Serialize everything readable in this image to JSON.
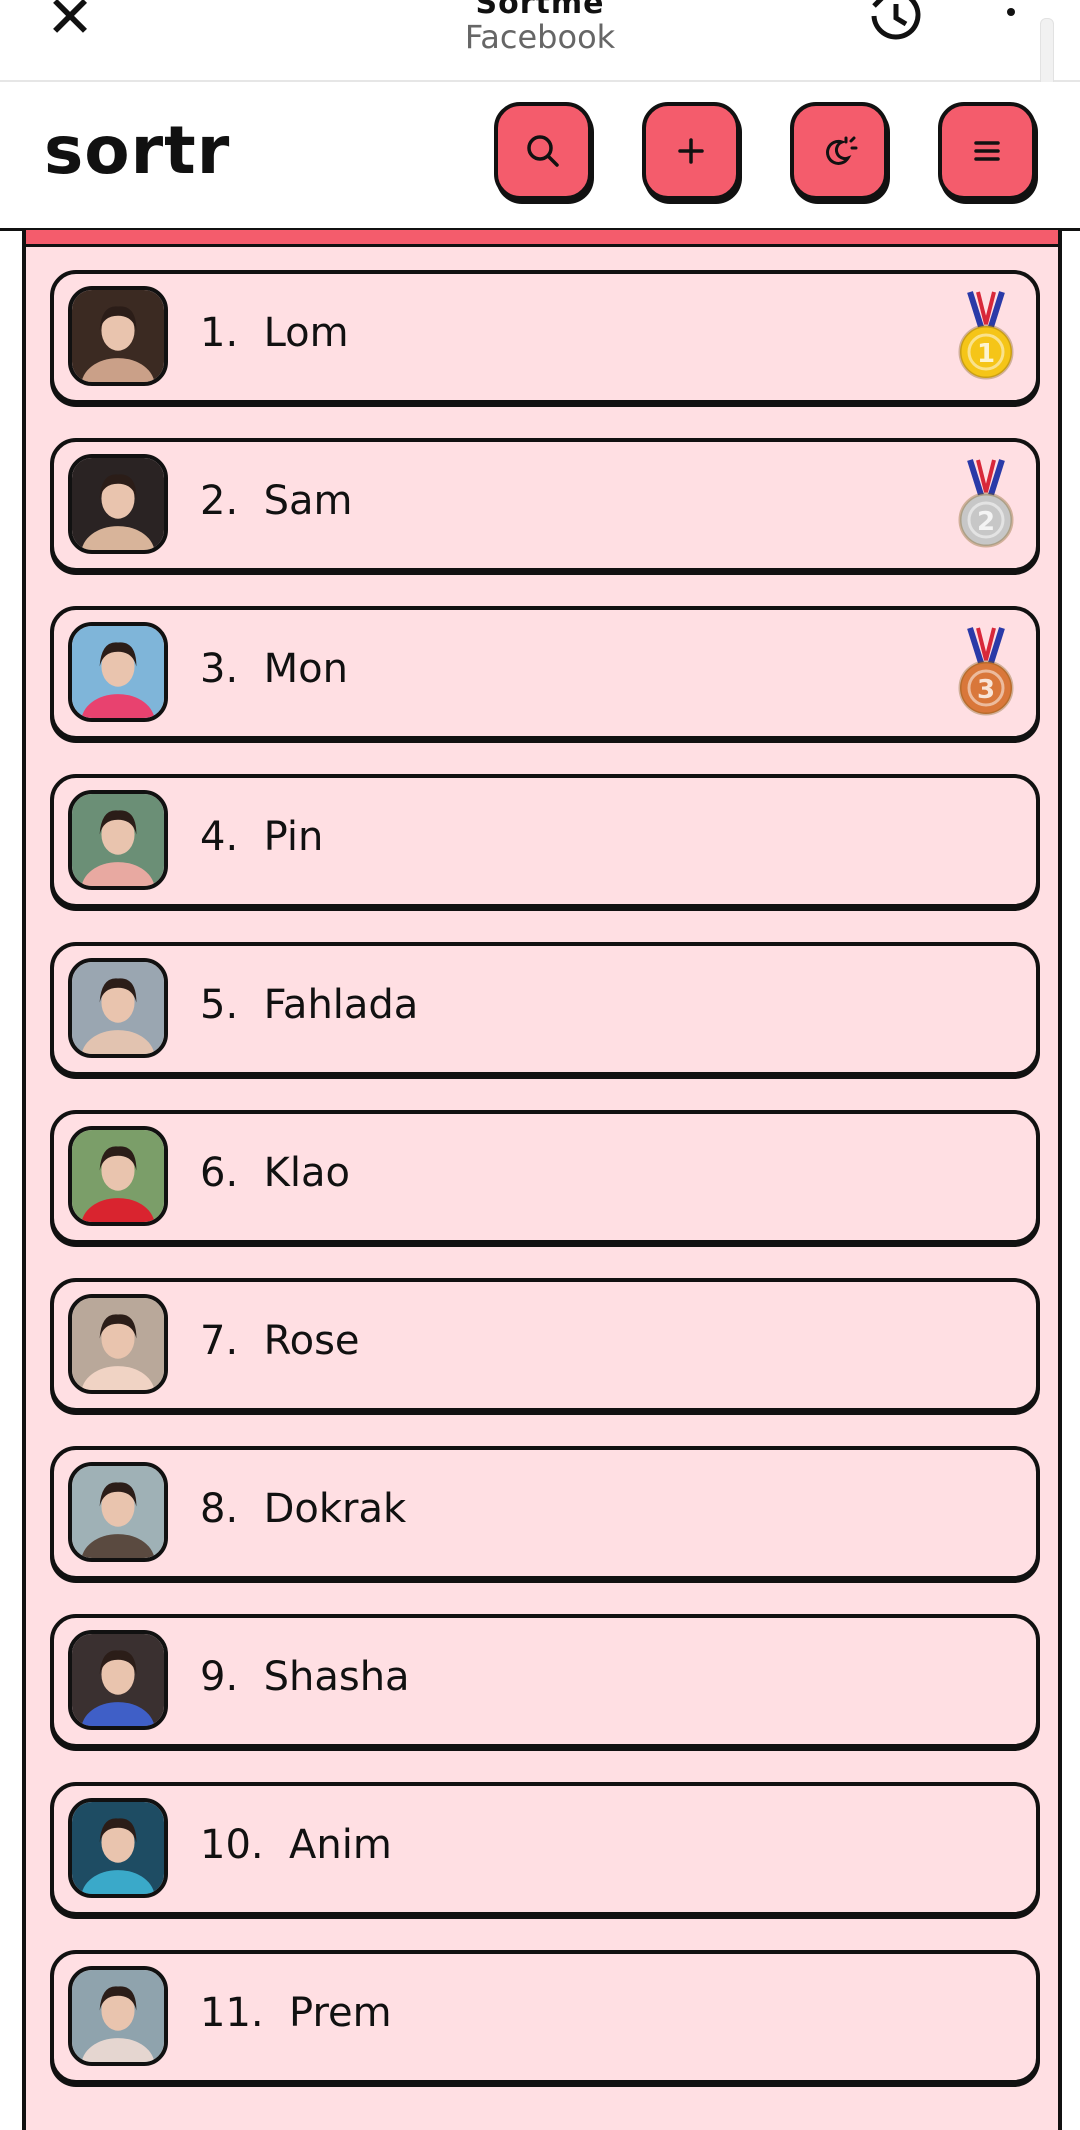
{
  "browser": {
    "title": "Sortme",
    "subtitle": "Facebook",
    "close_icon": "close-icon",
    "history_icon": "history-icon",
    "more_icon": "more-vertical-icon"
  },
  "header": {
    "logo": "sortr",
    "buttons": [
      {
        "name": "search-button",
        "icon": "search-icon"
      },
      {
        "name": "add-button",
        "icon": "plus-icon"
      },
      {
        "name": "theme-button",
        "icon": "theme-icon"
      },
      {
        "name": "menu-button",
        "icon": "menu-icon"
      }
    ]
  },
  "colors": {
    "accent": "#f45c6c",
    "panel": "#ffdfe3",
    "outline": "#111111",
    "gold": "#f5c518",
    "silver": "#c7c7c7",
    "bronze": "#d9773a"
  },
  "ranking": [
    {
      "rank": "1.",
      "name": "Lom",
      "medal": "gold",
      "label": "1.  Lom"
    },
    {
      "rank": "2.",
      "name": "Sam",
      "medal": "silver",
      "label": "2.  Sam"
    },
    {
      "rank": "3.",
      "name": "Mon",
      "medal": "bronze",
      "label": "3.  Mon"
    },
    {
      "rank": "4.",
      "name": "Pin",
      "medal": null,
      "label": "4.  Pin"
    },
    {
      "rank": "5.",
      "name": "Fahlada",
      "medal": null,
      "label": "5.  Fahlada"
    },
    {
      "rank": "6.",
      "name": "Klao",
      "medal": null,
      "label": "6.  Klao"
    },
    {
      "rank": "7.",
      "name": "Rose",
      "medal": null,
      "label": "7.  Rose"
    },
    {
      "rank": "8.",
      "name": "Dokrak",
      "medal": null,
      "label": "8.  Dokrak"
    },
    {
      "rank": "9.",
      "name": "Shasha",
      "medal": null,
      "label": "9.  Shasha"
    },
    {
      "rank": "10.",
      "name": "Anim",
      "medal": null,
      "label": "10.  Anim"
    },
    {
      "rank": "11.",
      "name": "Prem",
      "medal": null,
      "label": "11.  Prem"
    }
  ]
}
